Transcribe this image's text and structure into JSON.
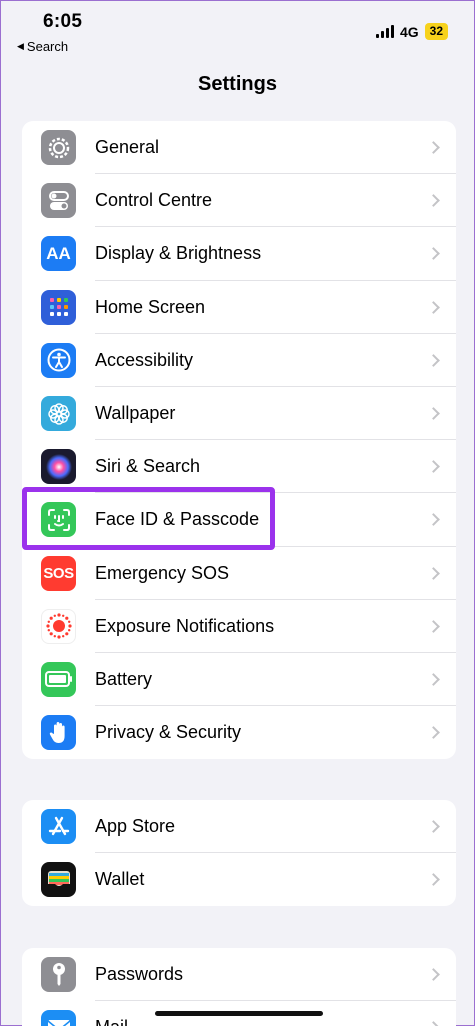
{
  "status": {
    "time": "6:05",
    "back_label": "Search",
    "network": "4G",
    "battery": "32"
  },
  "nav": {
    "title": "Settings"
  },
  "group1": [
    {
      "label": "General",
      "icon": "gear-icon",
      "color": "#8e8e93"
    },
    {
      "label": "Control Centre",
      "icon": "toggles-icon",
      "color": "#8e8e93"
    },
    {
      "label": "Display & Brightness",
      "icon": "text-size-icon",
      "color": "#1c7cf4"
    },
    {
      "label": "Home Screen",
      "icon": "app-grid-icon",
      "color": "#2f5fd9"
    },
    {
      "label": "Accessibility",
      "icon": "accessibility-person-icon",
      "color": "#1c7cf4"
    },
    {
      "label": "Wallpaper",
      "icon": "flower-icon",
      "color": "#34aadc"
    },
    {
      "label": "Siri & Search",
      "icon": "siri-orb-icon",
      "color": "#1a1a2e"
    },
    {
      "label": "Face ID & Passcode",
      "icon": "face-id-icon",
      "color": "#34c759"
    },
    {
      "label": "Emergency SOS",
      "icon": "sos-icon",
      "color": "#ff3b30",
      "icon_text": "SOS"
    },
    {
      "label": "Exposure Notifications",
      "icon": "exposure-dots-icon",
      "color": "#ffffff"
    },
    {
      "label": "Battery",
      "icon": "battery-icon",
      "color": "#34c759"
    },
    {
      "label": "Privacy & Security",
      "icon": "hand-icon",
      "color": "#1c7cf4"
    }
  ],
  "group2": [
    {
      "label": "App Store",
      "icon": "app-store-icon",
      "color": "#1c8ef4"
    },
    {
      "label": "Wallet",
      "icon": "wallet-icon",
      "color": "#111111"
    }
  ],
  "group3": [
    {
      "label": "Passwords",
      "icon": "key-icon",
      "color": "#8e8e93"
    },
    {
      "label": "Mail",
      "icon": "mail-icon",
      "color": "#1c8ef4"
    }
  ]
}
